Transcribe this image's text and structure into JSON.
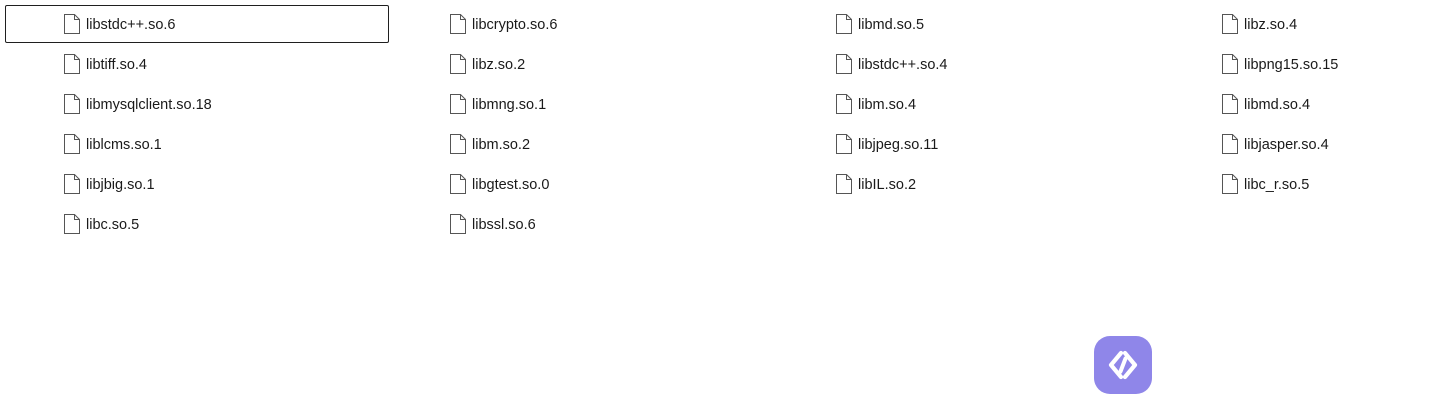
{
  "files": [
    {
      "name": "libstdc++.so.6",
      "selected": true
    },
    {
      "name": "libcrypto.so.6"
    },
    {
      "name": "libmd.so.5"
    },
    {
      "name": "libz.so.4"
    },
    {
      "name": "libtiff.so.4"
    },
    {
      "name": "libz.so.2"
    },
    {
      "name": "libstdc++.so.4"
    },
    {
      "name": "libpng15.so.15"
    },
    {
      "name": "libmysqlclient.so.18"
    },
    {
      "name": "libmng.so.1"
    },
    {
      "name": "libm.so.4"
    },
    {
      "name": "libmd.so.4"
    },
    {
      "name": "liblcms.so.1"
    },
    {
      "name": "libm.so.2"
    },
    {
      "name": "libjpeg.so.11"
    },
    {
      "name": "libjasper.so.4"
    },
    {
      "name": "libjbig.so.1"
    },
    {
      "name": "libgtest.so.0"
    },
    {
      "name": "libIL.so.2"
    },
    {
      "name": "libc_r.so.5"
    },
    {
      "name": "libc.so.5"
    },
    {
      "name": "libssl.so.6"
    }
  ],
  "icons": {
    "file": "file-icon",
    "logo": "app-logo-icon"
  },
  "colors": {
    "logo_bg": "#8f86e9",
    "selection_border": "#1f1f1f"
  }
}
